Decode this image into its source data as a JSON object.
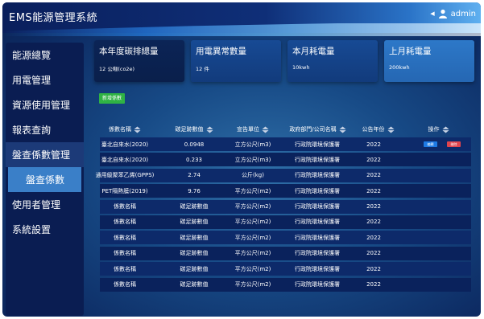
{
  "app": {
    "title": "EMS能源管理系統",
    "user": "admin"
  },
  "sidebar": {
    "items": [
      {
        "label": "能源總覽"
      },
      {
        "label": "用電管理"
      },
      {
        "label": "資源使用管理"
      },
      {
        "label": "報表查詢"
      },
      {
        "label": "盤查係數管理"
      },
      {
        "label": "盤查係數"
      },
      {
        "label": "使用者管理"
      },
      {
        "label": "系統設置"
      }
    ]
  },
  "cards": [
    {
      "title": "本年度碳排總量",
      "value": "12 公噸(co2e)"
    },
    {
      "title": "用電異常數量",
      "value": "12 件"
    },
    {
      "title": "本月耗電量",
      "value": "10kwh"
    },
    {
      "title": "上月耗電量",
      "value": "200kwh"
    }
  ],
  "toolbar": {
    "add_label": "新增係數"
  },
  "table": {
    "headers": [
      "係數名稱",
      "碳足跡數值",
      "宣告單位",
      "政府部門/公司名稱",
      "公告年份",
      "操作"
    ],
    "actions": {
      "edit": "編輯",
      "delete": "刪除"
    },
    "rows": [
      [
        "臺北自來水(2020)",
        "0.0948",
        "立方公尺(m3)",
        "行政院環境保護署",
        "2022"
      ],
      [
        "臺北自來水(2020)",
        "0.233",
        "立方公尺(m3)",
        "行政院環境保護署",
        "2022"
      ],
      [
        "通用級聚苯乙烯(GPPS)",
        "2.74",
        "公斤(kg)",
        "行政院環境保護署",
        "2022"
      ],
      [
        "PET隔熱膜(2019)",
        "9.76",
        "平方公尺(m2)",
        "行政院環境保護署",
        "2022"
      ],
      [
        "係數名稱",
        "碳足跡數值",
        "平方公尺(m2)",
        "行政院環境保護署",
        "2022"
      ],
      [
        "係數名稱",
        "碳足跡數值",
        "平方公尺(m2)",
        "行政院環境保護署",
        "2022"
      ],
      [
        "係數名稱",
        "碳足跡數值",
        "平方公尺(m2)",
        "行政院環境保護署",
        "2022"
      ],
      [
        "係數名稱",
        "碳足跡數值",
        "平方公尺(m2)",
        "行政院環境保護署",
        "2022"
      ],
      [
        "係數名稱",
        "碳足跡數值",
        "平方公尺(m2)",
        "行政院環境保護署",
        "2022"
      ],
      [
        "係數名稱",
        "碳足跡數值",
        "平方公尺(m2)",
        "行政院環境保護署",
        "2022"
      ]
    ]
  }
}
